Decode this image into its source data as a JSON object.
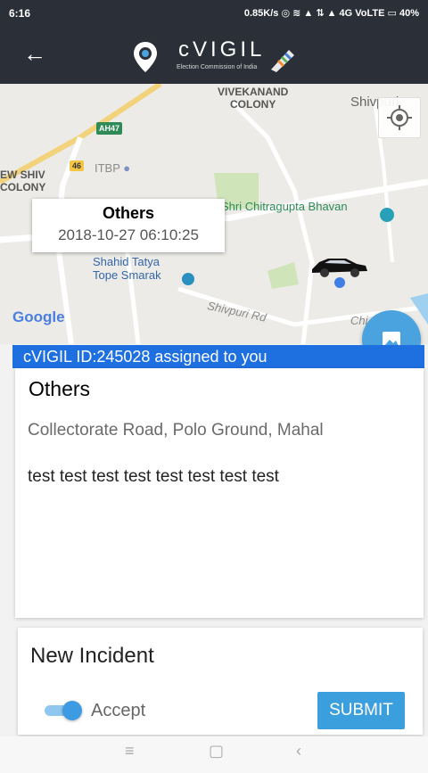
{
  "status_bar": {
    "time": "6:16",
    "indicators": "0.85K/s ◎ ≋ ▲ ⇅ ▲ 4G VoLTE ▭ 40%"
  },
  "app_bar": {
    "title": "cVIGIL",
    "subtitle": "Election Commission of India",
    "icon_names": [
      "back-arrow-icon",
      "location-pin-icon",
      "inked-finger-icon"
    ]
  },
  "map": {
    "area_labels": {
      "vivekanand": "VIVEKANAND\nCOLONY",
      "shivpuri": "Shivpuri",
      "ew_shiv": "EW SHIV\nCOLONY"
    },
    "road_badges": [
      "AH47",
      "46"
    ],
    "pois": {
      "itbp": "ITBP",
      "chitragupta": "Shri Chitragupta Bhavan",
      "shahid": "Shahid Tatya\nTope Smarak",
      "shivpuri_rd": "Shivpuri Rd",
      "chi": "Chi"
    },
    "attribution": "Google",
    "info_window": {
      "title": "Others",
      "timestamp": "2018-10-27 06:10:25"
    }
  },
  "incident": {
    "banner": "cVIGIL ID:245028 assigned to you",
    "category": "Others",
    "address": "Collectorate Road, Polo Ground, Mahal",
    "description": "test test test test test test test test"
  },
  "new_incident": {
    "heading": "New Incident",
    "toggle_label": "Accept",
    "toggle_on": true,
    "submit_label": "SUBMIT"
  },
  "nav_bar": {
    "menu": "≡",
    "home": "▢",
    "back": "‹"
  },
  "colors": {
    "appbar": "#2b2f37",
    "accent": "#3b9fde",
    "banner": "#1e6fe0"
  }
}
